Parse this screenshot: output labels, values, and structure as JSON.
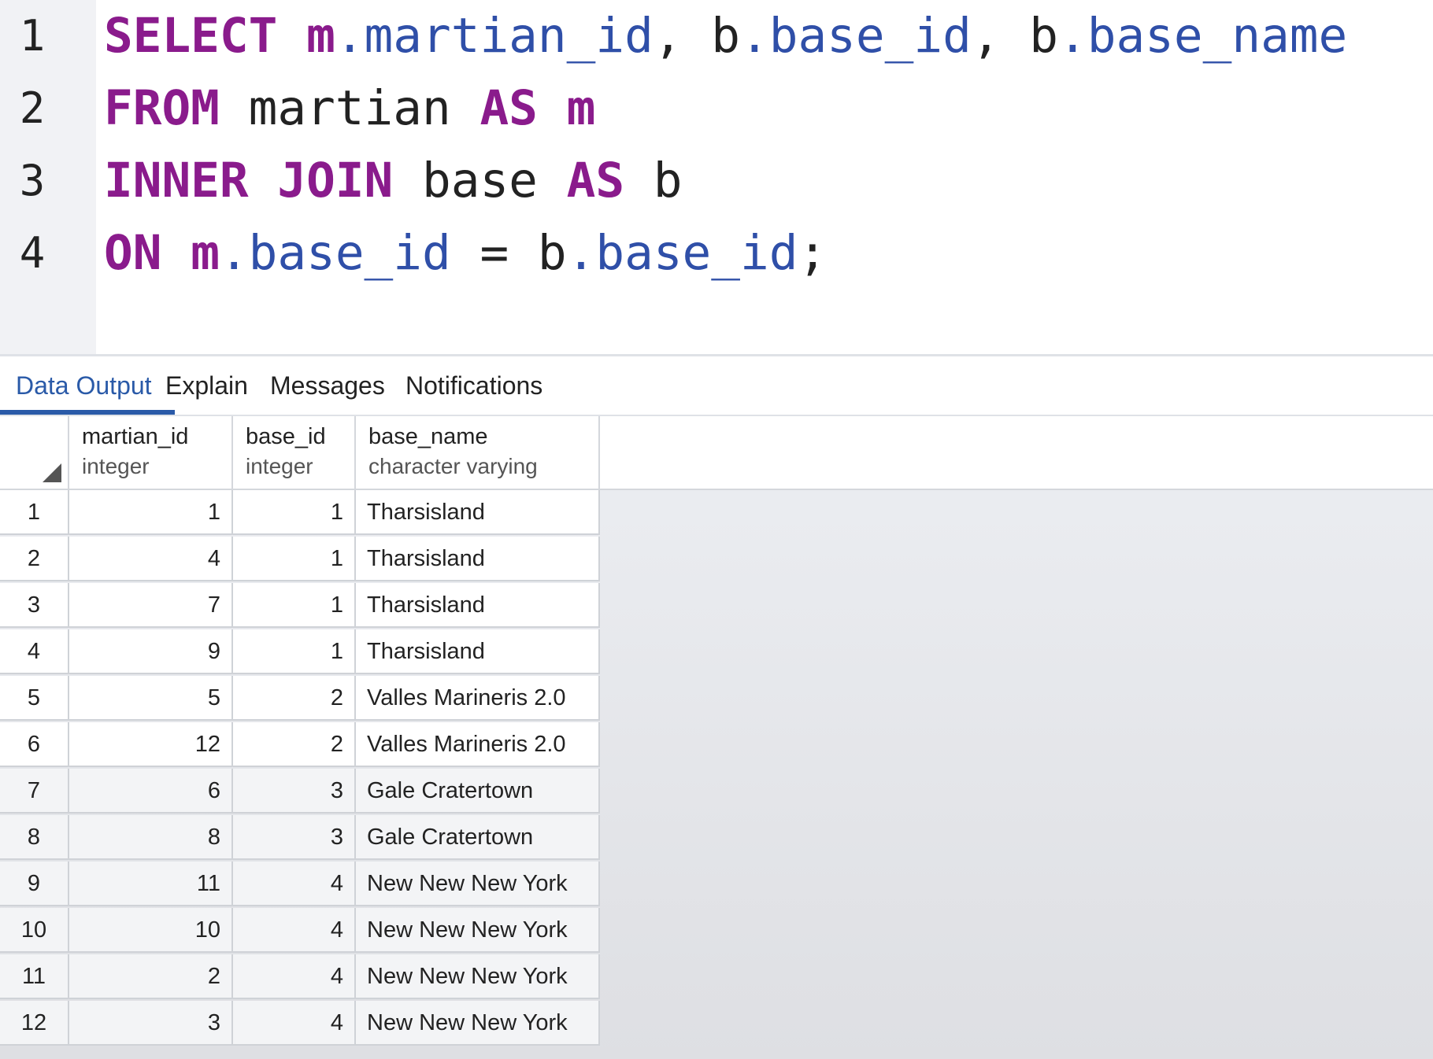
{
  "editor": {
    "line_numbers": [
      "1",
      "2",
      "3",
      "4"
    ],
    "lines": [
      [
        {
          "t": "SELECT",
          "c": "kw"
        },
        {
          "t": " ",
          "c": "pl"
        },
        {
          "t": "m",
          "c": "al"
        },
        {
          "t": ".martian_id",
          "c": "col"
        },
        {
          "t": ", ",
          "c": "pl"
        },
        {
          "t": "b",
          "c": "pl"
        },
        {
          "t": ".base_id",
          "c": "col"
        },
        {
          "t": ", ",
          "c": "pl"
        },
        {
          "t": "b",
          "c": "pl"
        },
        {
          "t": ".base_name",
          "c": "col"
        }
      ],
      [
        {
          "t": "FROM",
          "c": "kw"
        },
        {
          "t": " martian ",
          "c": "pl"
        },
        {
          "t": "AS",
          "c": "kw"
        },
        {
          "t": " ",
          "c": "pl"
        },
        {
          "t": "m",
          "c": "al"
        }
      ],
      [
        {
          "t": "INNER JOIN",
          "c": "kw"
        },
        {
          "t": " base ",
          "c": "pl"
        },
        {
          "t": "AS",
          "c": "kw"
        },
        {
          "t": " b",
          "c": "pl"
        }
      ],
      [
        {
          "t": "ON",
          "c": "kw"
        },
        {
          "t": " ",
          "c": "pl"
        },
        {
          "t": "m",
          "c": "al"
        },
        {
          "t": ".base_id",
          "c": "col"
        },
        {
          "t": " = ",
          "c": "pl"
        },
        {
          "t": "b",
          "c": "pl"
        },
        {
          "t": ".base_id",
          "c": "col"
        },
        {
          "t": ";",
          "c": "pl"
        }
      ]
    ]
  },
  "tabs": [
    {
      "label": "Data Output",
      "active": true
    },
    {
      "label": "Explain",
      "active": false
    },
    {
      "label": "Messages",
      "active": false
    },
    {
      "label": "Notifications",
      "active": false
    }
  ],
  "grid": {
    "columns": [
      {
        "name": "martian_id",
        "type": "integer"
      },
      {
        "name": "base_id",
        "type": "integer"
      },
      {
        "name": "base_name",
        "type": "character varying"
      }
    ],
    "rows": [
      [
        "1",
        "1",
        "1",
        "Tharsisland"
      ],
      [
        "2",
        "4",
        "1",
        "Tharsisland"
      ],
      [
        "3",
        "7",
        "1",
        "Tharsisland"
      ],
      [
        "4",
        "9",
        "1",
        "Tharsisland"
      ],
      [
        "5",
        "5",
        "2",
        "Valles Marineris 2.0"
      ],
      [
        "6",
        "12",
        "2",
        "Valles Marineris 2.0"
      ],
      [
        "7",
        "6",
        "3",
        "Gale Cratertown"
      ],
      [
        "8",
        "8",
        "3",
        "Gale Cratertown"
      ],
      [
        "9",
        "11",
        "4",
        "New New New York"
      ],
      [
        "10",
        "10",
        "4",
        "New New New York"
      ],
      [
        "11",
        "2",
        "4",
        "New New New York"
      ],
      [
        "12",
        "3",
        "4",
        "New New New York"
      ]
    ]
  },
  "colors": {
    "keyword": "#8a1b8c",
    "column": "#2f4fa8",
    "active_tab": "#2a5aa8"
  }
}
